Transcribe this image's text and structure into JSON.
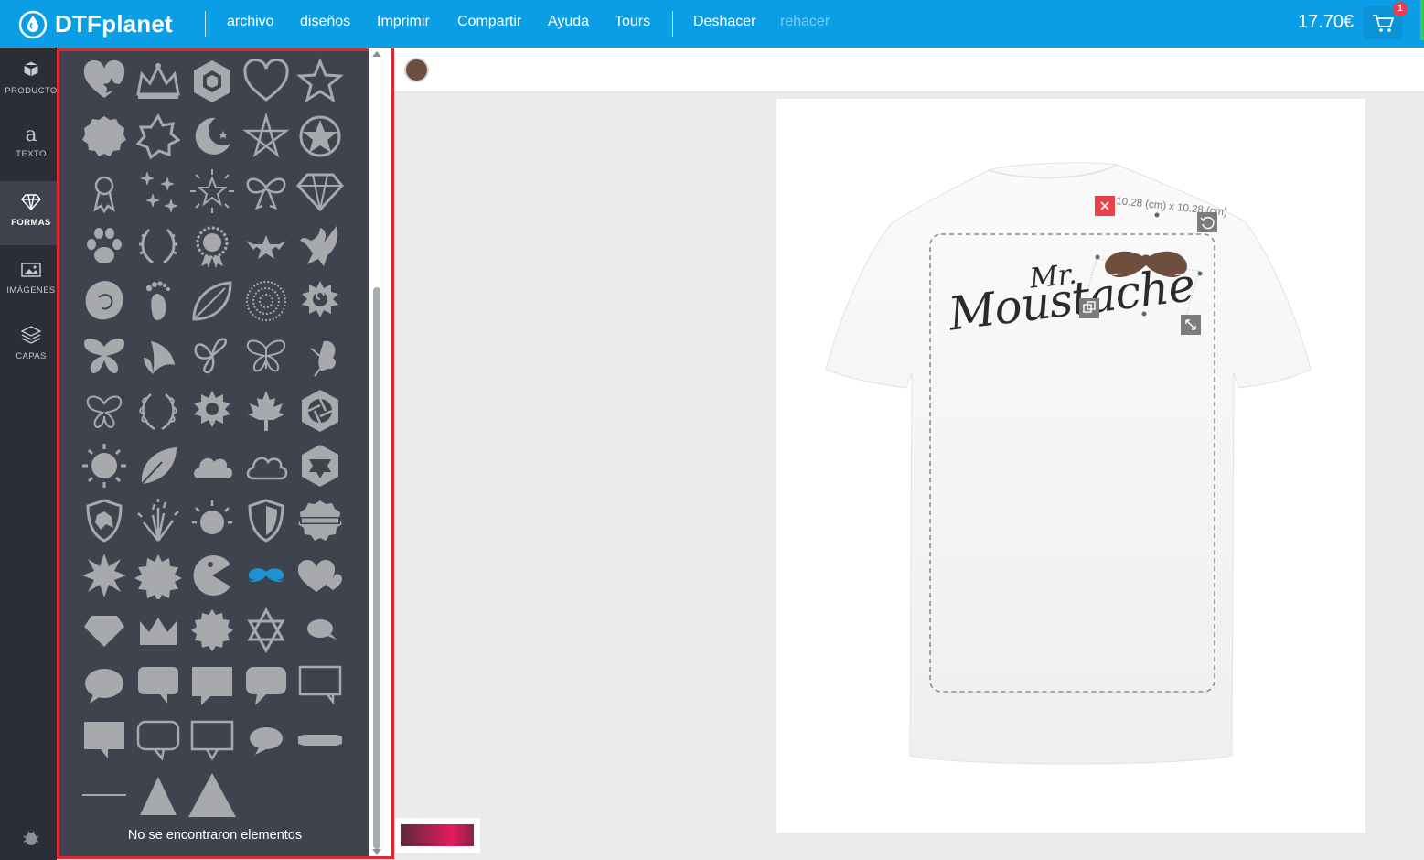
{
  "app": {
    "logo_text": "DTFplanet",
    "accent_color": "#0a9ee7"
  },
  "topbar": {
    "menu": [
      "archivo",
      "diseños",
      "Imprimir",
      "Compartir",
      "Ayuda",
      "Tours"
    ],
    "undo_label": "Deshacer",
    "redo_label": "rehacer",
    "price": "17.70€",
    "cart_count": "1"
  },
  "sidenav": {
    "items": [
      {
        "label": "PRODUCTO",
        "icon": "cube-icon"
      },
      {
        "label": "TEXTO",
        "icon": "text-icon"
      },
      {
        "label": "FORMAS",
        "icon": "diamond-icon"
      },
      {
        "label": "IMÁGENES",
        "icon": "image-icon"
      },
      {
        "label": "CAPAS",
        "icon": "layers-icon"
      }
    ],
    "active": "FORMAS"
  },
  "shapes_panel": {
    "selected_shape": "moustache-shape",
    "selected_color": "#1e93d3",
    "shapes": [
      "heart-star",
      "crown",
      "hexagon",
      "heart",
      "star",
      "badge",
      "star-outline",
      "crescent-moon",
      "pentagram",
      "star-circle",
      "rosette",
      "sparkles",
      "star-burst",
      "bow",
      "diamond",
      "paw",
      "laurel",
      "medal",
      "winged-star",
      "eagle",
      "lion",
      "footprint",
      "leaf",
      "mandala",
      "spiral-sun",
      "butterfly",
      "butterfly-side",
      "butterfly-swirl",
      "butterfly-lined",
      "butterfly-small",
      "butterfly-outline",
      "laurel-wreath",
      "gear-sun",
      "maple-leaf",
      "camera-aperture",
      "sun",
      "leaf-simple",
      "cloud",
      "cloud-outline",
      "hex-star",
      "wolf-shield",
      "fireworks",
      "sun-rays",
      "shield",
      "ribbon-badge",
      "burst-8",
      "burst-12",
      "pacman",
      "moustache",
      "hearts",
      "gem",
      "crown-simple",
      "seal",
      "star-of-david",
      "speech-small",
      "speech-round",
      "speech-rect",
      "speech-square",
      "speech-tail",
      "speech-outline",
      "speech-rect-2",
      "speech-outline-2",
      "speech-outline-3",
      "speech-oval",
      "banner",
      "line",
      "triangle",
      "triangle-large"
    ],
    "empty_message": "No se encontraron elementos"
  },
  "canvas": {
    "product_color": "#6e4e3f",
    "design_text_1": "Mr.",
    "design_text_2": "Moustache",
    "dimensions_label": "10.28 (cm) x 10.28 (cm)"
  }
}
